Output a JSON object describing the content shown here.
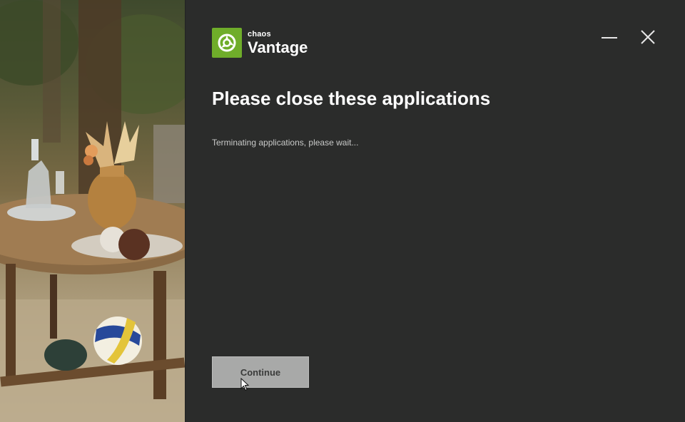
{
  "brand": {
    "company": "chaos",
    "product": "Vantage",
    "accent_color": "#6fad2a",
    "logo_icon": "vantage-logo-icon"
  },
  "window": {
    "minimize_icon": "minimize-icon",
    "close_icon": "close-icon"
  },
  "main": {
    "title": "Please close these applications",
    "status_text": "Terminating applications, please wait...",
    "continue_label": "Continue"
  },
  "hero": {
    "image": "patio-table-photo"
  }
}
